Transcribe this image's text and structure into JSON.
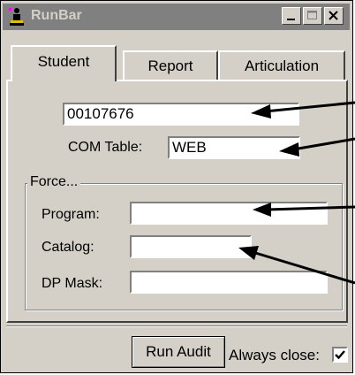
{
  "window": {
    "title": "RunBar",
    "icon": "runner-icon",
    "controls": [
      "minimize-icon",
      "maximize-icon",
      "close-icon"
    ]
  },
  "tabs": [
    {
      "label": "Student",
      "selected": true
    },
    {
      "label": "Report",
      "selected": false
    },
    {
      "label": "Articulation",
      "selected": false
    }
  ],
  "student": {
    "id_value": "00107676",
    "com_table_label": "COM Table:",
    "com_table_value": "WEB"
  },
  "force": {
    "title": "Force...",
    "program_label": "Program:",
    "program_value": "",
    "catalog_label": "Catalog:",
    "catalog_value": "",
    "dp_mask_label": "DP Mask:",
    "dp_mask_value": ""
  },
  "footer": {
    "run_button": "Run Audit",
    "always_close_label": "Always close:",
    "always_close_checked": true
  },
  "colors": {
    "face": "#d4d0c8",
    "titlebar_inactive": "#808080",
    "annotation_arrows": "#000000"
  }
}
